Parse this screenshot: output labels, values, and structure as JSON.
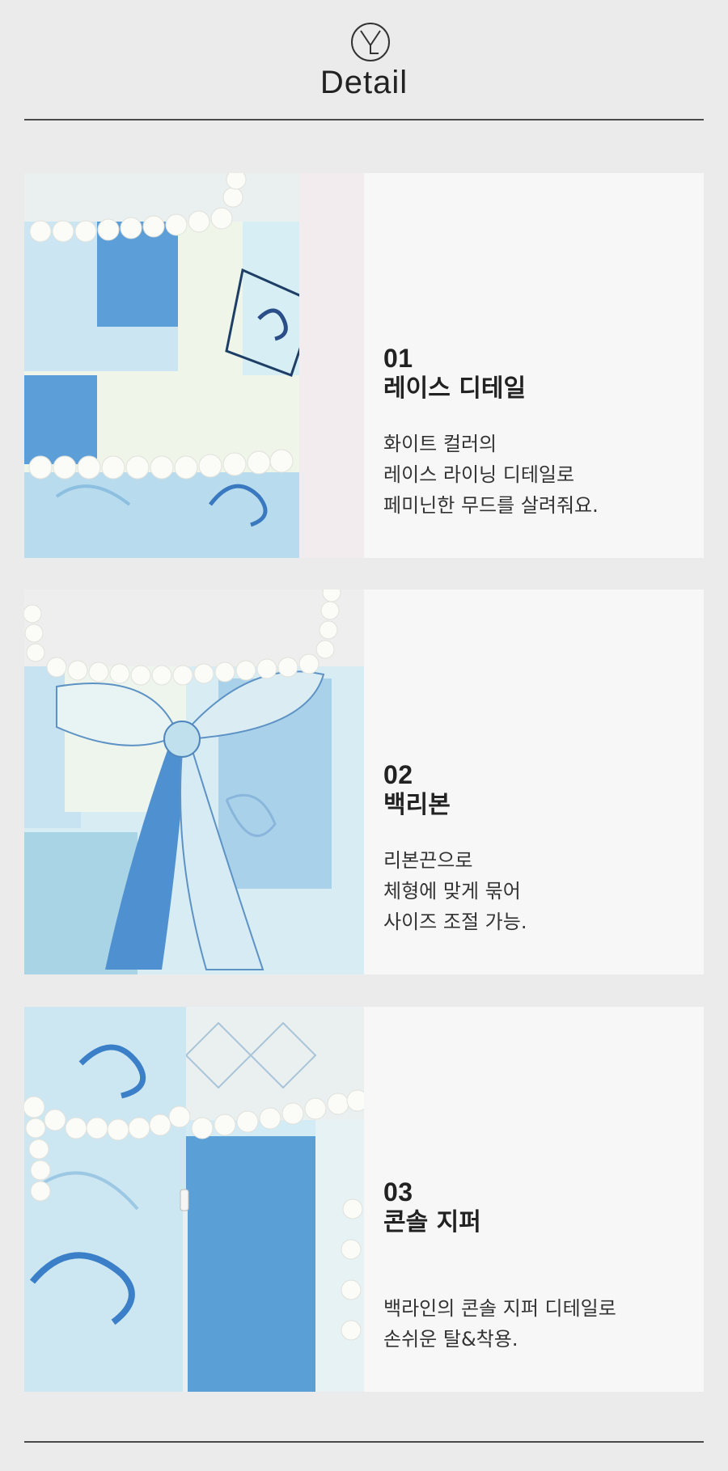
{
  "header": {
    "title": "Detail",
    "logo": "YL monogram logo"
  },
  "sections": [
    {
      "number": "01",
      "heading": "레이스 디테일",
      "description": [
        "화이트 컬러의",
        "레이스 라이닝 디테일로",
        "페미닌한 무드를 살려줘요."
      ],
      "image": "lace-detail-photo"
    },
    {
      "number": "02",
      "heading": "백리본",
      "description": [
        "리본끈으로",
        "체형에 맞게 묶어",
        "사이즈 조절 가능."
      ],
      "image": "back-ribbon-photo"
    },
    {
      "number": "03",
      "heading": "콘솔 지퍼",
      "description": [
        "백라인의 콘솔 지퍼 디테일로",
        "손쉬운 탈&착용."
      ],
      "image": "concealed-zipper-photo"
    }
  ],
  "colors": {
    "background": "#ebebeb",
    "panel": "#f7f7f7",
    "fabric_blue": "#5a9fd6",
    "fabric_light": "#bfe1ef",
    "lace": "#ffffff"
  }
}
